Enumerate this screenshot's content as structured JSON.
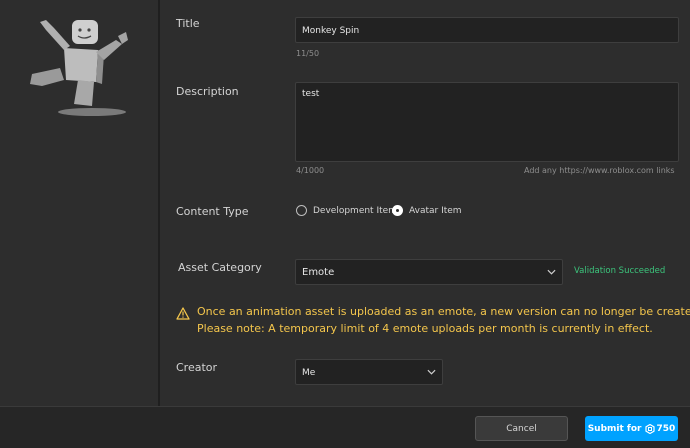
{
  "form": {
    "title_label": "Title",
    "title_value": "Monkey Spin",
    "title_count": "11/50",
    "description_label": "Description",
    "description_value": "test",
    "description_count": "4/1000",
    "description_hint": "Add any https://www.roblox.com links",
    "content_type_label": "Content Type",
    "content_type_options": [
      "Development Item",
      "Avatar Item"
    ],
    "content_type_selected": "Avatar Item",
    "asset_category_label": "Asset Category",
    "asset_category_value": "Emote",
    "validation_status": "Validation Succeeded",
    "warning_line1": "Once an animation asset is uploaded as an emote, a new version can no longer be created.",
    "warning_line2": "Please note: A temporary limit of 4 emote uploads per month is currently in effect.",
    "creator_label": "Creator",
    "creator_value": "Me"
  },
  "footer": {
    "cancel_label": "Cancel",
    "submit_label": "Submit for",
    "submit_price": "750"
  },
  "colors": {
    "accent": "#00a2ff",
    "warning": "#f4c64c",
    "success": "#3cc47c"
  }
}
